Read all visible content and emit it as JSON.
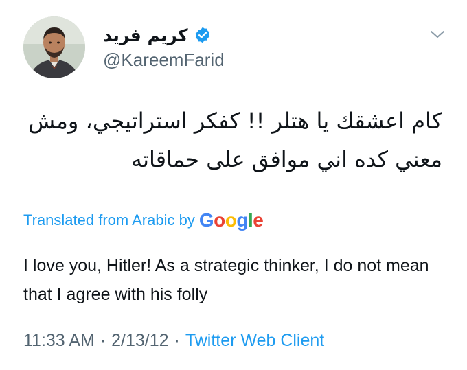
{
  "user": {
    "display_name": "كريم فريد",
    "handle": "@KareemFarid",
    "verified": true
  },
  "tweet": {
    "text_ar": "كام اعشقك يا هتلر !! كفكر استراتيجي، ومش معني كده اني موافق على حماقاته",
    "translated_label": "Translated from Arabic by",
    "translator_brand": [
      "G",
      "o",
      "o",
      "g",
      "l",
      "e"
    ],
    "translation": "I love you, Hitler! As a strategic thinker, I do not mean that I agree with his folly",
    "time": "11:33 AM",
    "date": "2/13/12",
    "separator": "·",
    "client": "Twitter Web Client"
  },
  "icons": {
    "avatar": "user-avatar-photo",
    "verified": "verified-badge-icon",
    "caret": "chevron-down-icon"
  },
  "colors": {
    "link_blue": "#1d9bf0",
    "secondary_text": "#536471",
    "google_blue": "#4285F4",
    "google_red": "#EA4335",
    "google_yellow": "#FBBC05",
    "google_green": "#34A853"
  }
}
